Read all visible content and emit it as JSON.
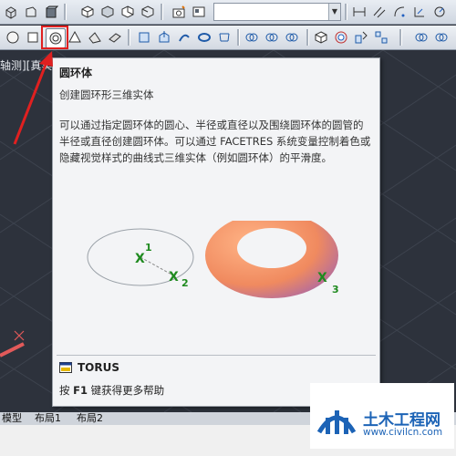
{
  "viewport": {
    "label": "轴测][真实"
  },
  "tooltip": {
    "title": "圆环体",
    "subtitle": "创建圆环形三维实体",
    "description": "可以通过指定圆环体的圆心、半径或直径以及围绕圆环体的圆管的半径或直径创建圆环体。可以通过 FACETRES 系统变量控制着色或隐藏视觉样式的曲线式三维实体（例如圆环体）的平滑度。",
    "figure": {
      "point1": "1",
      "point2": "2",
      "point3": "3",
      "marker": "X"
    },
    "command": "TORUS",
    "help_key": "F1",
    "help_prefix": "按 ",
    "help_suffix": " 键获得更多帮助"
  },
  "tabs": {
    "model": "模型",
    "layout1": "布局1",
    "layout2": "布局2"
  },
  "watermark": {
    "title": "土木工程网",
    "url": "www.civilcn.com"
  },
  "colors": {
    "accent_red": "#e02020",
    "torus_orange": "#f39a66",
    "torus_purple": "#8a5fd0",
    "marker_green": "#1f8a1f"
  }
}
